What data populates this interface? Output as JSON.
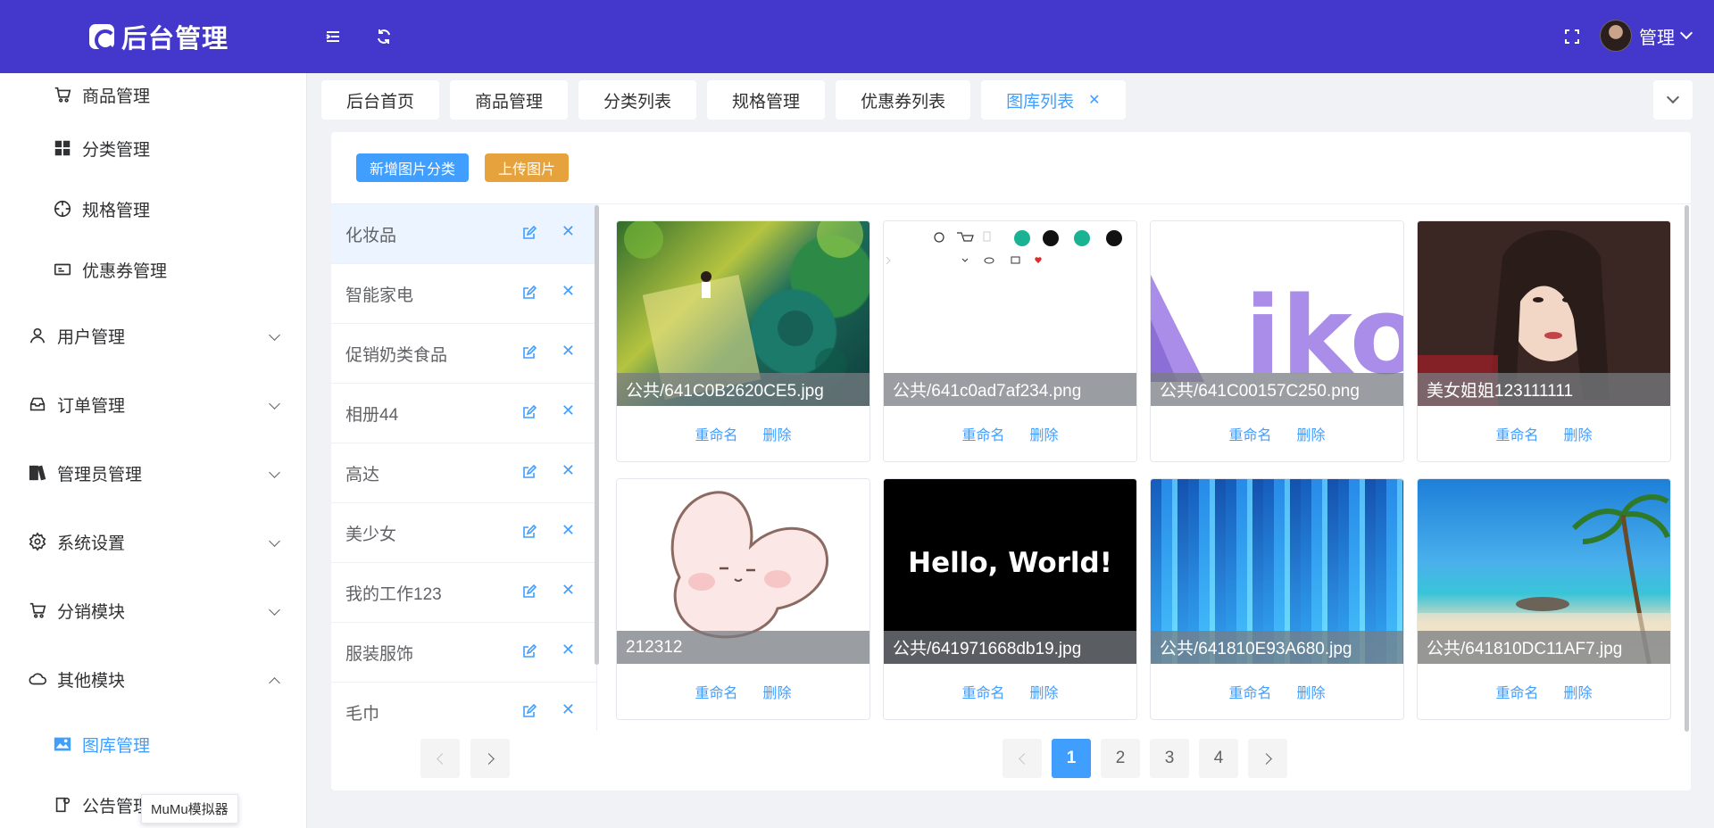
{
  "header": {
    "title": "后台管理",
    "user_name": "管理"
  },
  "sidebar": {
    "items": [
      {
        "label": "商品管理",
        "icon": "cart-icon"
      },
      {
        "label": "分类管理",
        "icon": "grid-icon"
      },
      {
        "label": "规格管理",
        "icon": "target-icon"
      },
      {
        "label": "优惠券管理",
        "icon": "ticket-icon"
      },
      {
        "label": "用户管理",
        "icon": "user-icon"
      },
      {
        "label": "订单管理",
        "icon": "inbox-icon"
      },
      {
        "label": "管理员管理",
        "icon": "book-icon"
      },
      {
        "label": "系统设置",
        "icon": "gear-icon"
      },
      {
        "label": "分销模块",
        "icon": "cart-icon"
      },
      {
        "label": "其他模块",
        "icon": "cloud-icon"
      },
      {
        "label": "图库管理",
        "icon": "image-icon"
      },
      {
        "label": "公告管理",
        "icon": "notice-icon"
      }
    ],
    "tooltip": "MuMu模拟器"
  },
  "tabs": [
    {
      "label": "后台首页"
    },
    {
      "label": "商品管理"
    },
    {
      "label": "分类列表"
    },
    {
      "label": "规格管理"
    },
    {
      "label": "优惠券列表"
    },
    {
      "label": "图库列表",
      "active": true
    }
  ],
  "toolbar": {
    "add_category": "新增图片分类",
    "upload_image": "上传图片"
  },
  "categories": [
    {
      "name": "化妆品"
    },
    {
      "name": "智能家电"
    },
    {
      "name": "促销奶类食品"
    },
    {
      "name": "相册44"
    },
    {
      "name": "高达"
    },
    {
      "name": "美少女"
    },
    {
      "name": "我的工作123"
    },
    {
      "name": "服装服饰"
    },
    {
      "name": "毛巾"
    }
  ],
  "images": [
    {
      "title": "公共/641C0B2620CE5.jpg"
    },
    {
      "title": "公共/641c0ad7af234.png"
    },
    {
      "title": "公共/641C00157C250.png"
    },
    {
      "title": "美女姐姐123111111"
    },
    {
      "title": "212312"
    },
    {
      "title": "公共/641971668db19.jpg",
      "content_text": "Hello, World!"
    },
    {
      "title": "公共/641810E93A680.jpg"
    },
    {
      "title": "公共/641810DC11AF7.jpg"
    }
  ],
  "image_art_text": {
    "aiko": "iko"
  },
  "card_actions": {
    "rename": "重命名",
    "delete": "删除"
  },
  "pager": {
    "pages": [
      "1",
      "2",
      "3",
      "4"
    ],
    "current": "1"
  },
  "colors": {
    "header_bg": "#4337cc",
    "primary": "#409eff",
    "warning": "#e6a23c"
  }
}
